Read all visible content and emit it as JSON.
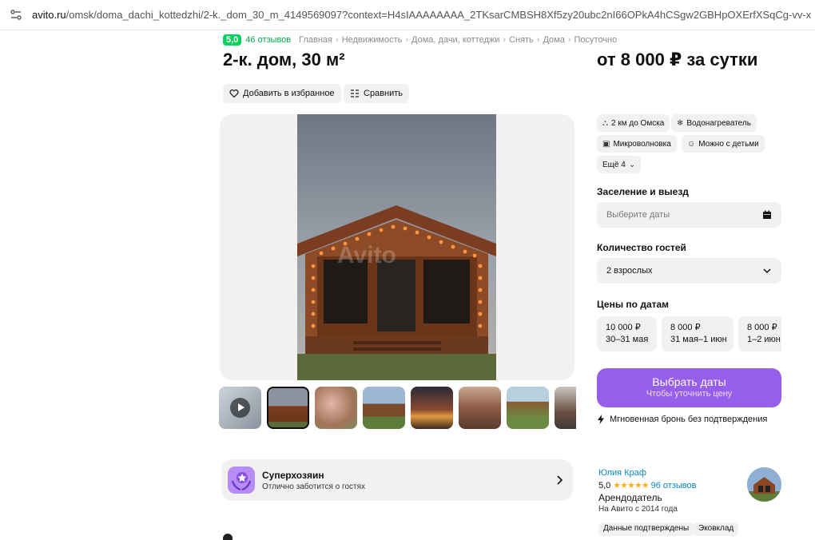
{
  "browser": {
    "url_host": "avito.ru",
    "url_path": "/omsk/doma_dachi_kottedzhi/2-k._dom_30_m_4149569097?context=H4sIAAAAAAAA_2TKsarCMBSH8Xf5zy20ubc2nI66OPkA4hCSgw2GBHpOXErfXSqCg-vv-xz90So0EvzM_"
  },
  "breadcrumbs": {
    "rating": "5,0",
    "reviews": "46 отзывов",
    "items": [
      "Главная",
      "Недвижимость",
      "Дома, дачи, коттеджи",
      "Снять",
      "Дома",
      "Посуточно"
    ],
    "separator": "›"
  },
  "listing": {
    "title": "2-к. дом, 30 м²",
    "price": "от 8 000 ₽ за сутки",
    "favorite_label": "Добавить в избранное",
    "compare_label": "Сравнить"
  },
  "gallery": {
    "watermark": "Avito",
    "thumbnail_count": 8,
    "active_index": 1
  },
  "features": [
    {
      "icon": "distance-icon",
      "label": "2 км до Омска"
    },
    {
      "icon": "snowflake-icon",
      "label": "Водонагреватель"
    },
    {
      "icon": "microwave-icon",
      "label": "Микроволновка"
    },
    {
      "icon": "child-icon",
      "label": "Можно с детьми"
    },
    {
      "icon": "chevron-down-icon",
      "label": "Ещё 4"
    }
  ],
  "booking": {
    "dates_label": "Заселение и выезд",
    "dates_placeholder": "Выберите даты",
    "guests_label": "Количество гостей",
    "guests_value": "2 взрослых",
    "prices_label": "Цены по датам",
    "price_cards": [
      {
        "price": "10 000 ₽",
        "dates": "30–31 мая"
      },
      {
        "price": "8 000 ₽",
        "dates": "31 мая–1 июн"
      },
      {
        "price": "8 000 ₽",
        "dates": "1–2 июн"
      }
    ],
    "cta_main": "Выбрать даты",
    "cta_sub": "Чтобы уточнить цену",
    "instant": "Мгновенная бронь без подтверждения"
  },
  "superhost": {
    "title": "Суперхозяин",
    "subtitle": "Отлично заботится о гостях"
  },
  "seller": {
    "name": "Юлия Краф",
    "rating": "5,0",
    "stars": "★★★★★",
    "reviews": "96 отзывов",
    "role": "Арендодатель",
    "since": "На Авито с 2014 года",
    "tags": [
      "Данные подтверждены",
      "Эковклад"
    ]
  },
  "colors": {
    "accent": "#965eeb",
    "rating_green": "#02d15c",
    "link_blue": "#0a88c7",
    "chip_bg": "#f2f1f0"
  }
}
